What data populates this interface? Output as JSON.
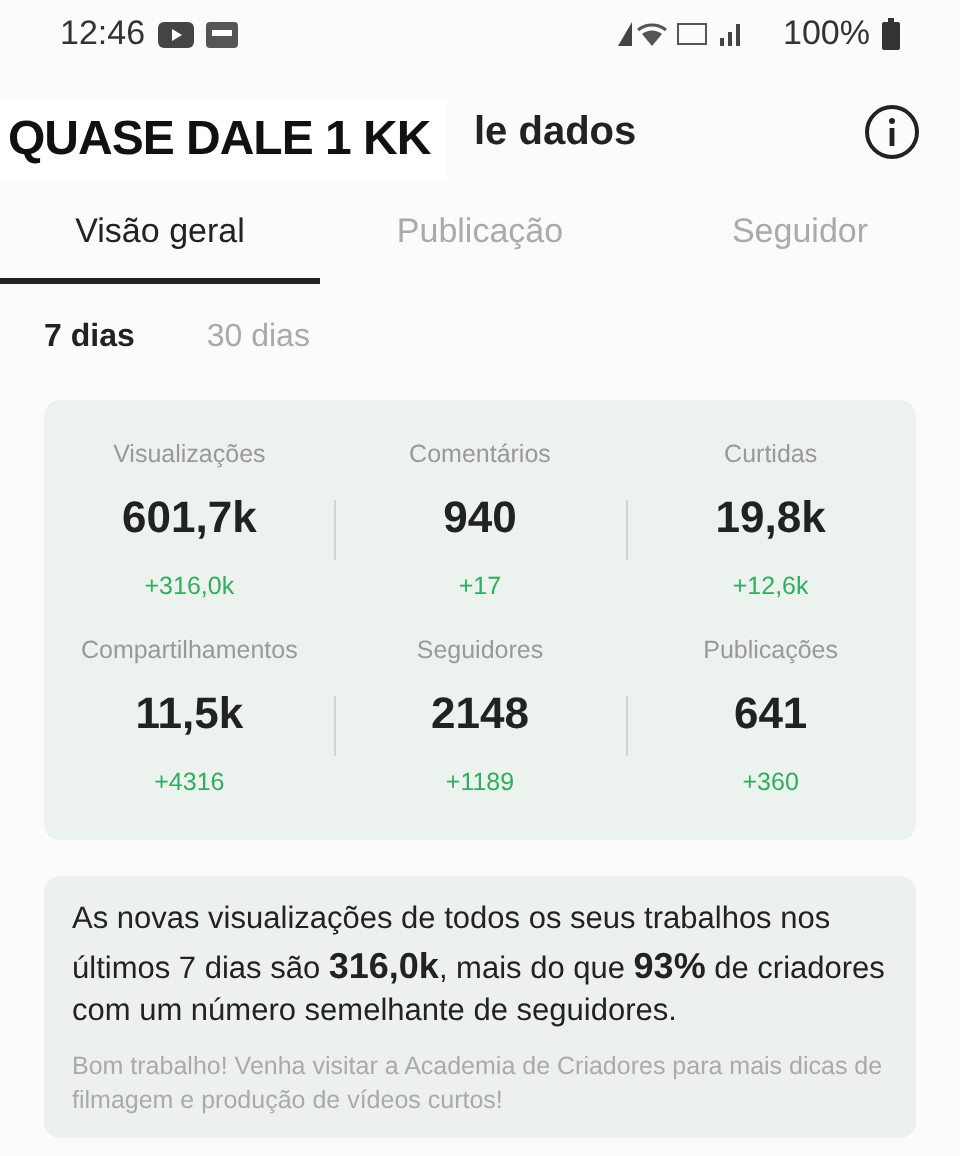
{
  "status_bar": {
    "time": "12:46",
    "battery": "100%"
  },
  "header": {
    "title": "le dados",
    "caption": "QUASE DALE 1 KK"
  },
  "tabs": [
    {
      "label": "Visão geral",
      "selected": true
    },
    {
      "label": "Publicação",
      "selected": false
    },
    {
      "label": "Seguidor",
      "selected": false
    }
  ],
  "periods": [
    {
      "label": "7 dias",
      "selected": true
    },
    {
      "label": "30 dias",
      "selected": false
    }
  ],
  "metrics": [
    {
      "label": "Visualizações",
      "value": "601,7k",
      "change": "+316,0k"
    },
    {
      "label": "Comentários",
      "value": "940",
      "change": "+17"
    },
    {
      "label": "Curtidas",
      "value": "19,8k",
      "change": "+12,6k"
    },
    {
      "label": "Compartilhamentos",
      "value": "11,5k",
      "change": "+4316"
    },
    {
      "label": "Seguidores",
      "value": "2148",
      "change": "+1189"
    },
    {
      "label": "Publicações",
      "value": "641",
      "change": "+360"
    }
  ],
  "insight": {
    "summary": "As novas visualizações de todos os seus trabalhos nos últimos 7 dias são **316,0k**, mais do que **93%** de criadores com um número semelhante de seguidores.",
    "tip": "Bom trabalho! Venha visitar a Academia de Criadores para mais dicas de filmagem e produção de vídeos curtos!"
  }
}
